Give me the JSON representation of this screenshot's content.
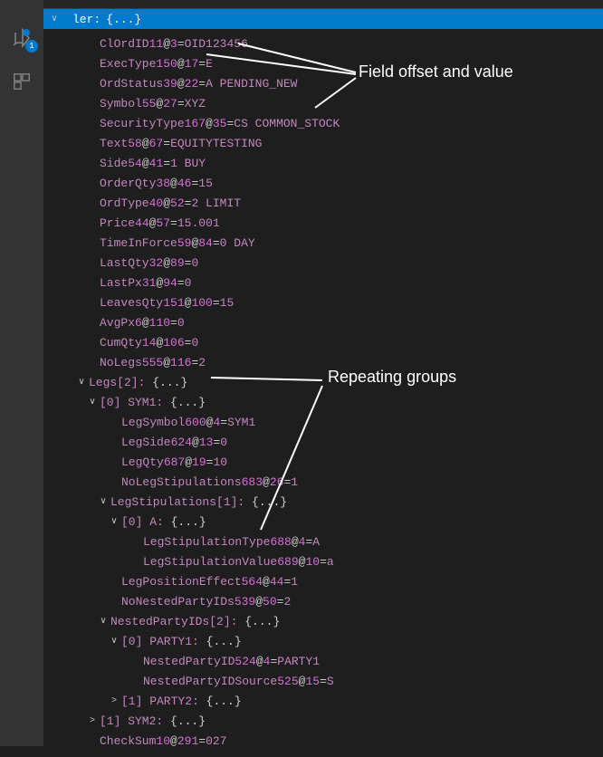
{
  "activity_bar": {
    "debug_badge": "1"
  },
  "header": {
    "label": "ler:",
    "braces": "{...}"
  },
  "rows": [
    {
      "indent": 2,
      "chev": "",
      "parts": [
        "ClOrdID",
        "11",
        "3",
        "OID123456"
      ]
    },
    {
      "indent": 2,
      "chev": "",
      "parts": [
        "ExecType",
        "150",
        "17",
        "E"
      ]
    },
    {
      "indent": 2,
      "chev": "",
      "parts": [
        "OrdStatus",
        "39",
        "22",
        "A PENDING_NEW"
      ]
    },
    {
      "indent": 2,
      "chev": "",
      "parts": [
        "Symbol",
        "55",
        "27",
        "XYZ"
      ]
    },
    {
      "indent": 2,
      "chev": "",
      "parts": [
        "SecurityType",
        "167",
        "35",
        "CS COMMON_STOCK"
      ]
    },
    {
      "indent": 2,
      "chev": "",
      "parts": [
        "Text",
        "58",
        "67",
        "EQUITYTESTING"
      ]
    },
    {
      "indent": 2,
      "chev": "",
      "parts": [
        "Side",
        "54",
        "41",
        "1 BUY"
      ]
    },
    {
      "indent": 2,
      "chev": "",
      "parts": [
        "OrderQty",
        "38",
        "46",
        "15"
      ]
    },
    {
      "indent": 2,
      "chev": "",
      "parts": [
        "OrdType",
        "40",
        "52",
        "2 LIMIT"
      ]
    },
    {
      "indent": 2,
      "chev": "",
      "parts": [
        "Price",
        "44",
        "57",
        "15.001"
      ]
    },
    {
      "indent": 2,
      "chev": "",
      "parts": [
        "TimeInForce",
        "59",
        "84",
        "0 DAY"
      ]
    },
    {
      "indent": 2,
      "chev": "",
      "parts": [
        "LastQty",
        "32",
        "89",
        "0"
      ]
    },
    {
      "indent": 2,
      "chev": "",
      "parts": [
        "LastPx",
        "31",
        "94",
        "0"
      ]
    },
    {
      "indent": 2,
      "chev": "",
      "parts": [
        "LeavesQty",
        "151",
        "100",
        "15"
      ]
    },
    {
      "indent": 2,
      "chev": "",
      "parts": [
        "AvgPx",
        "6",
        "110",
        "0"
      ]
    },
    {
      "indent": 2,
      "chev": "",
      "parts": [
        "CumQty",
        "14",
        "106",
        "0"
      ]
    },
    {
      "indent": 2,
      "chev": "",
      "parts": [
        "NoLegs",
        "555",
        "116",
        "2"
      ]
    },
    {
      "indent": 1,
      "chev": "down",
      "group": "Legs[2]:",
      "braces": "{...}"
    },
    {
      "indent": 2,
      "chev": "down",
      "group": "[0] SYM1:",
      "braces": "{...}"
    },
    {
      "indent": 4,
      "chev": "",
      "parts": [
        "LegSymbol",
        "600",
        "4",
        "SYM1"
      ]
    },
    {
      "indent": 4,
      "chev": "",
      "parts": [
        "LegSide",
        "624",
        "13",
        "0"
      ]
    },
    {
      "indent": 4,
      "chev": "",
      "parts": [
        "LegQty",
        "687",
        "19",
        "10"
      ]
    },
    {
      "indent": 4,
      "chev": "",
      "parts": [
        "NoLegStipulations",
        "683",
        "26",
        "1"
      ]
    },
    {
      "indent": 3,
      "chev": "down",
      "group": "LegStipulations[1]:",
      "braces": "{...}"
    },
    {
      "indent": 4,
      "chev": "down",
      "group": "[0] A:",
      "braces": "{...}"
    },
    {
      "indent": 6,
      "chev": "",
      "parts": [
        "LegStipulationType",
        "688",
        "4",
        "A"
      ]
    },
    {
      "indent": 6,
      "chev": "",
      "parts": [
        "LegStipulationValue",
        "689",
        "10",
        "a"
      ]
    },
    {
      "indent": 4,
      "chev": "",
      "parts": [
        "LegPositionEffect",
        "564",
        "44",
        "1"
      ]
    },
    {
      "indent": 4,
      "chev": "",
      "parts": [
        "NoNestedPartyIDs",
        "539",
        "50",
        "2"
      ]
    },
    {
      "indent": 3,
      "chev": "down",
      "group": "NestedPartyIDs[2]:",
      "braces": "{...}"
    },
    {
      "indent": 4,
      "chev": "down",
      "group": "[0] PARTY1:",
      "braces": "{...}"
    },
    {
      "indent": 6,
      "chev": "",
      "parts": [
        "NestedPartyID",
        "524",
        "4",
        "PARTY1"
      ]
    },
    {
      "indent": 6,
      "chev": "",
      "parts": [
        "NestedPartyIDSource",
        "525",
        "15",
        "S"
      ]
    },
    {
      "indent": 4,
      "chev": "right",
      "group": "[1] PARTY2:",
      "braces": "{...}"
    },
    {
      "indent": 2,
      "chev": "right",
      "group": "[1] SYM2:",
      "braces": "{...}"
    },
    {
      "indent": 2,
      "chev": "",
      "parts": [
        "CheckSum",
        "10",
        "291",
        "027"
      ]
    }
  ],
  "annotations": {
    "field_offset": "Field offset and value",
    "repeating_groups": "Repeating groups"
  }
}
